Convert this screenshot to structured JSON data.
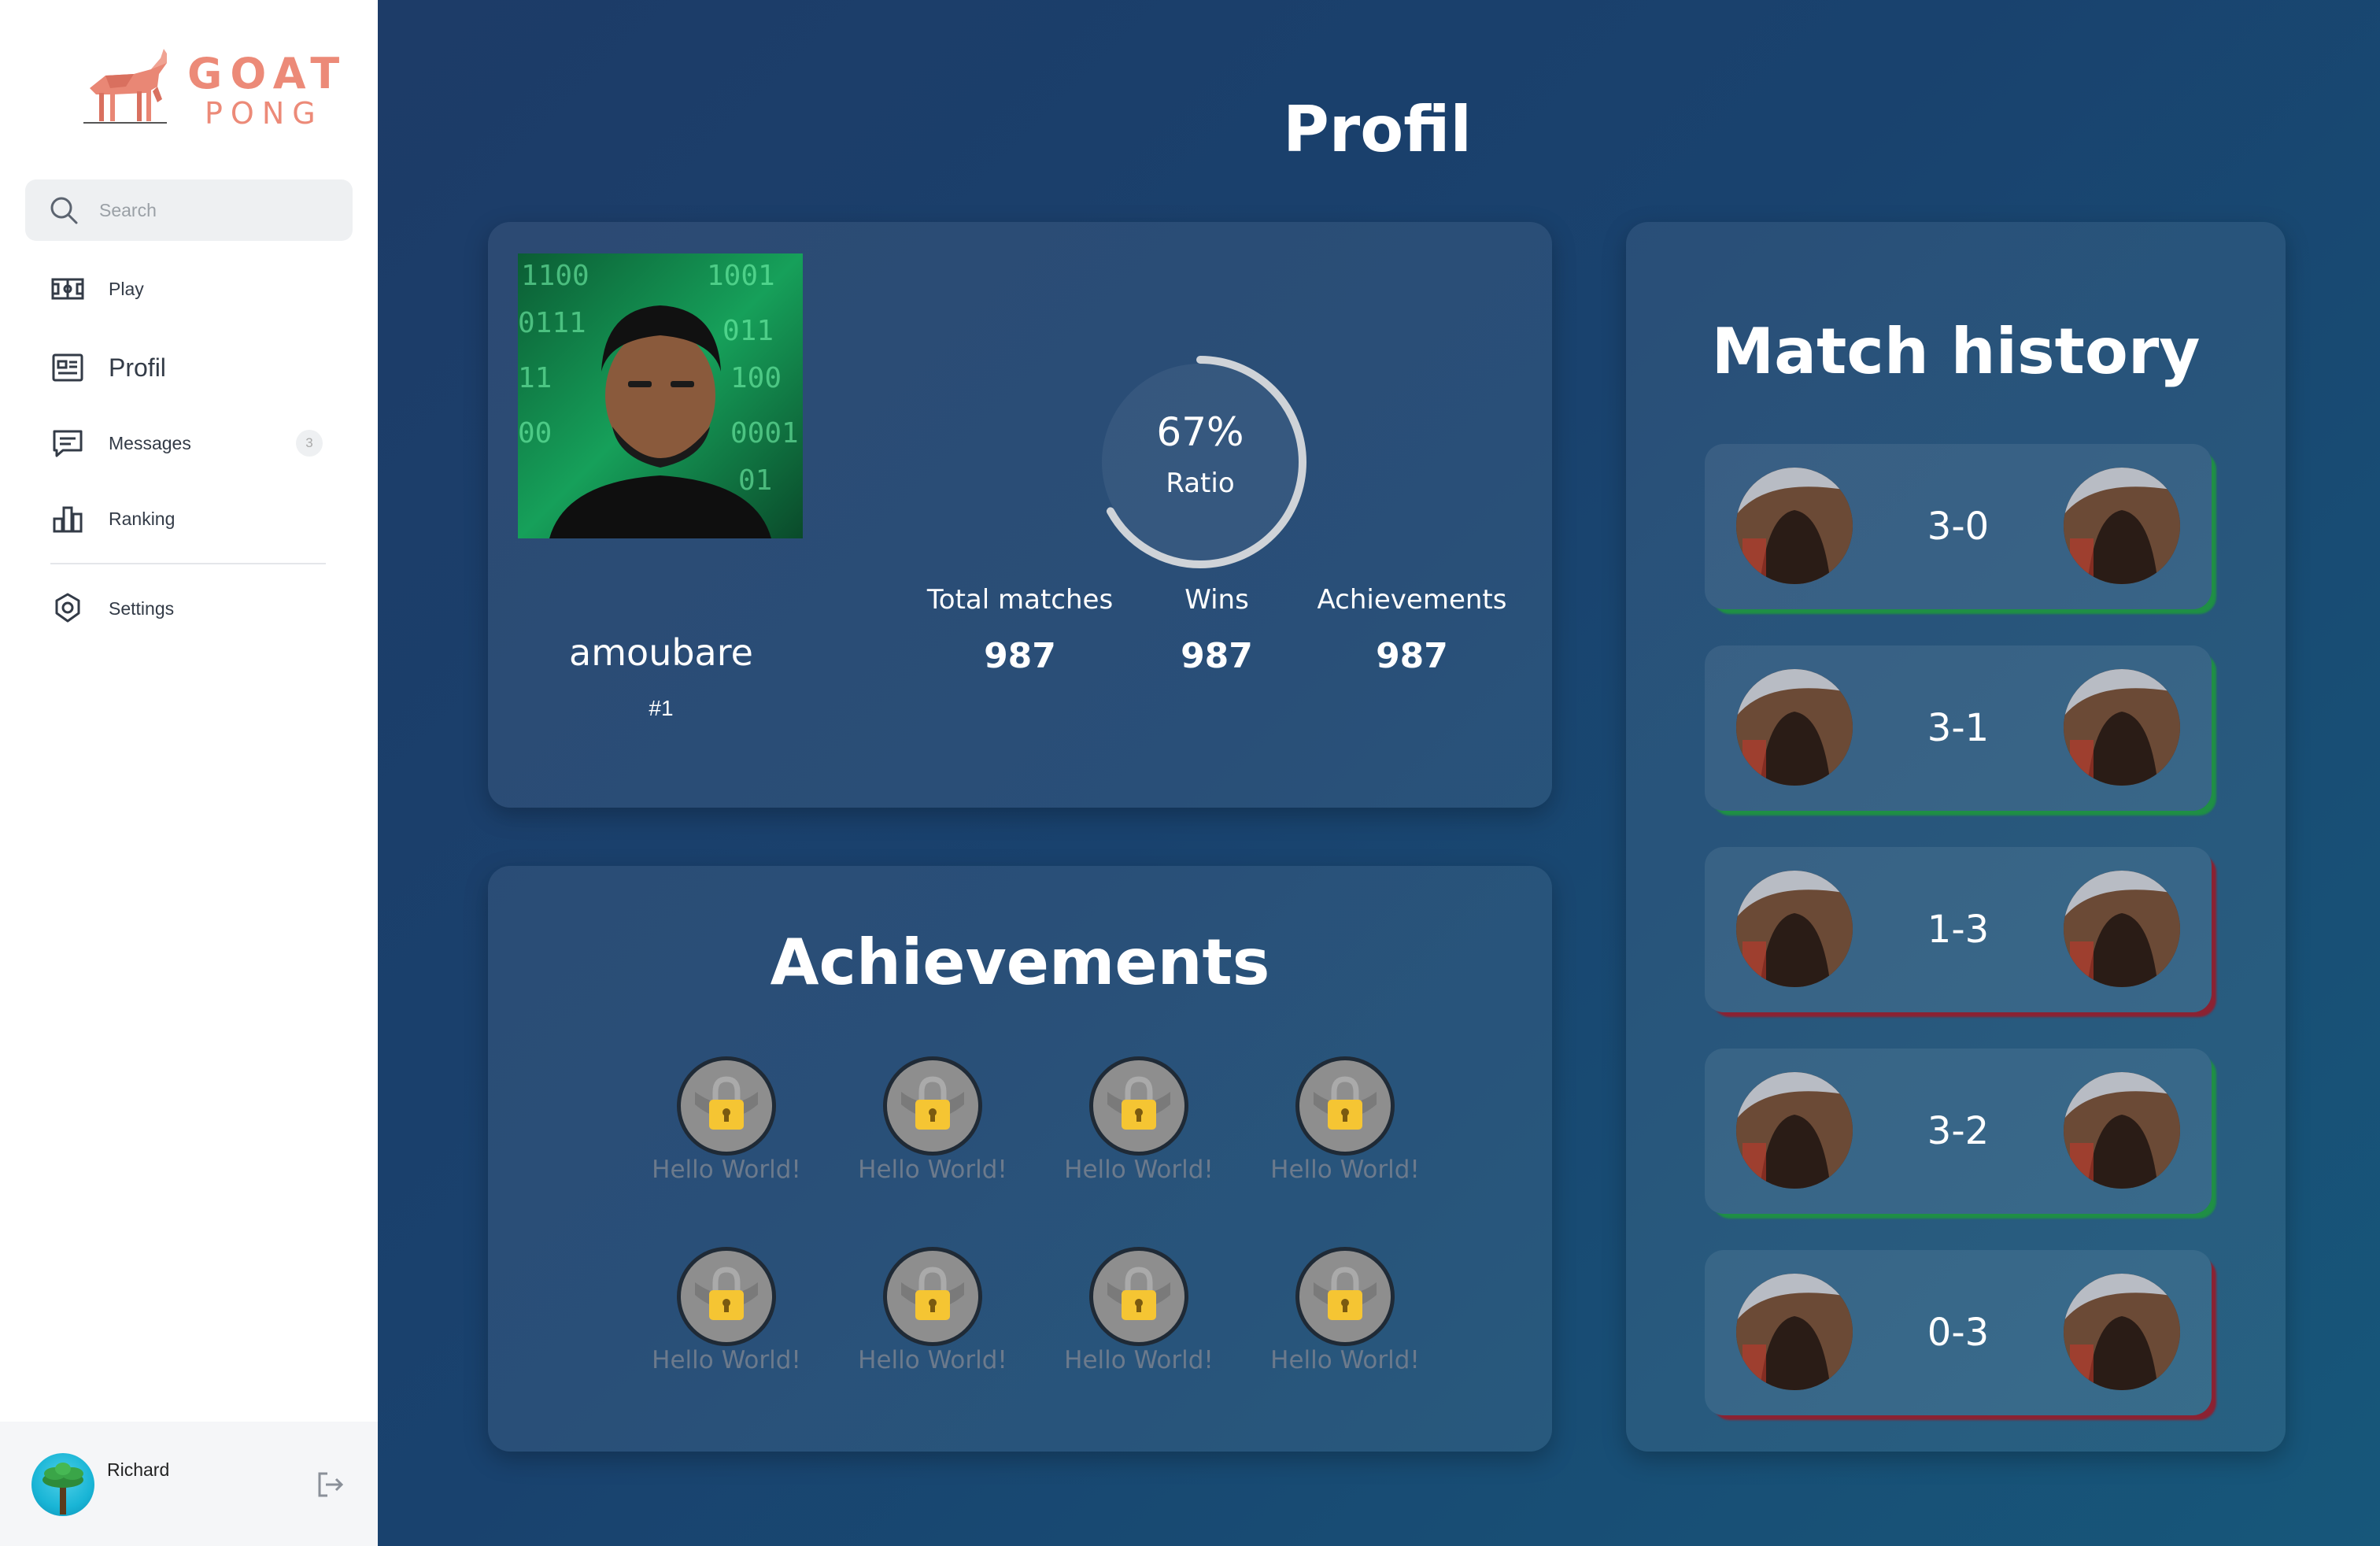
{
  "app": {
    "logo_word_1": "GOAT",
    "logo_word_2": "PONG",
    "accent_color": "#ec8a78"
  },
  "sidebar": {
    "search": {
      "placeholder": "Search"
    },
    "items": [
      {
        "label": "Play",
        "icon": "gamepad-icon"
      },
      {
        "label": "Profil",
        "icon": "profile-card-icon",
        "active": true
      },
      {
        "label": "Messages",
        "icon": "message-icon",
        "badge": "3"
      },
      {
        "label": "Ranking",
        "icon": "bar-chart-icon"
      },
      {
        "label": "Settings",
        "icon": "gear-icon"
      }
    ],
    "user": {
      "name": "Richard"
    }
  },
  "page": {
    "title": "Profil"
  },
  "profile": {
    "username": "amoubare",
    "rank": "#1",
    "ratio": {
      "value": "67%",
      "label": "Ratio",
      "fraction": 0.67
    },
    "stats": [
      {
        "label": "Total matches",
        "value": "987"
      },
      {
        "label": "Wins",
        "value": "987"
      },
      {
        "label": "Achievements",
        "value": "987"
      }
    ]
  },
  "achievements": {
    "title": "Achievements",
    "items": [
      {
        "label": "Hello World!",
        "locked": true
      },
      {
        "label": "Hello World!",
        "locked": true
      },
      {
        "label": "Hello World!",
        "locked": true
      },
      {
        "label": "Hello World!",
        "locked": true
      },
      {
        "label": "Hello World!",
        "locked": true
      },
      {
        "label": "Hello World!",
        "locked": true
      },
      {
        "label": "Hello World!",
        "locked": true
      },
      {
        "label": "Hello World!",
        "locked": true
      }
    ]
  },
  "match_history": {
    "title": "Match history",
    "win_color": "#1f8f45",
    "loss_color": "#8b2232",
    "matches": [
      {
        "score": "3-0",
        "result": "win"
      },
      {
        "score": "3-1",
        "result": "win"
      },
      {
        "score": "1-3",
        "result": "loss"
      },
      {
        "score": "3-2",
        "result": "win"
      },
      {
        "score": "0-3",
        "result": "loss"
      }
    ]
  }
}
